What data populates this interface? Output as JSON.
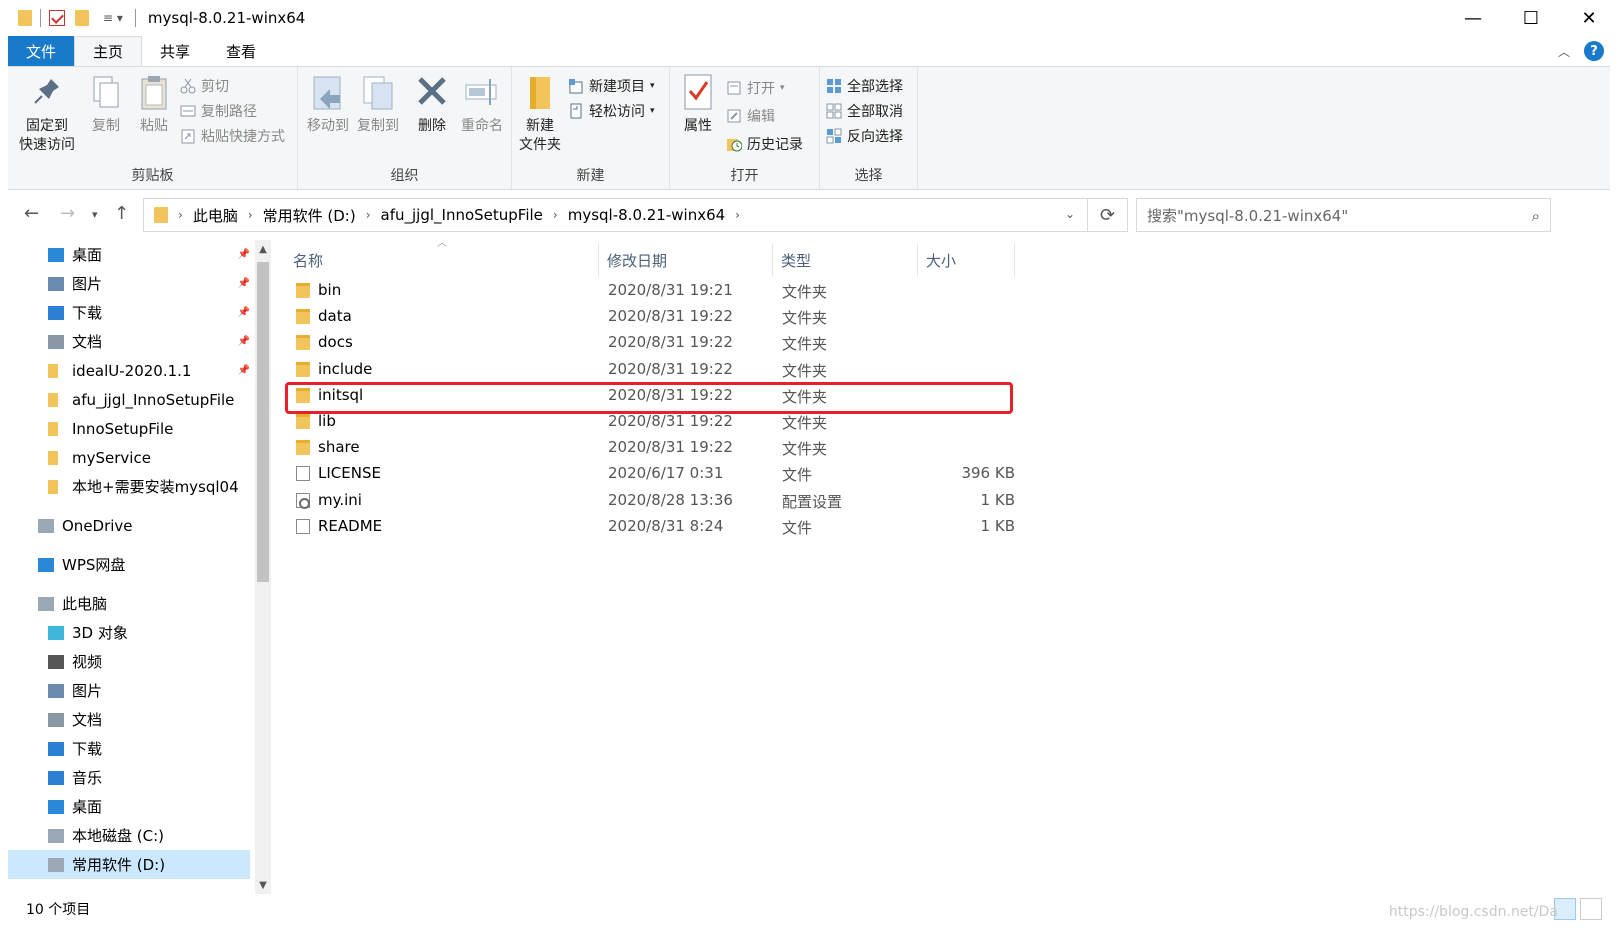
{
  "window": {
    "title": "mysql-8.0.21-winx64",
    "minimize": "—",
    "maximize": "☐",
    "close": "✕"
  },
  "ribbon_tabs": [
    {
      "label": "文件"
    },
    {
      "label": "主页"
    },
    {
      "label": "共享"
    },
    {
      "label": "查看"
    }
  ],
  "ribbon": {
    "clipboard": {
      "label": "剪贴板",
      "pin": "固定到\n快速访问",
      "copy": "复制",
      "paste": "粘贴",
      "cut": "剪切",
      "copy_path": "复制路径",
      "paste_shortcut": "粘贴快捷方式"
    },
    "organize": {
      "label": "组织",
      "move_to": "移动到",
      "copy_to": "复制到",
      "delete": "删除",
      "rename": "重命名"
    },
    "new": {
      "label": "新建",
      "new_folder": "新建\n文件夹",
      "new_item": "新建项目",
      "easy_access": "轻松访问"
    },
    "open": {
      "label": "打开",
      "properties": "属性",
      "open": "打开",
      "edit": "编辑",
      "history": "历史记录"
    },
    "select": {
      "label": "选择",
      "select_all": "全部选择",
      "select_none": "全部取消",
      "invert": "反向选择"
    }
  },
  "address": {
    "crumbs": [
      "此电脑",
      "常用软件 (D:)",
      "afu_jjgl_InnoSetupFile",
      "mysql-8.0.21-winx64"
    ],
    "search_placeholder": "搜索\"mysql-8.0.21-winx64\""
  },
  "nav_pane": {
    "quick_access": [
      {
        "label": "桌面",
        "icon": "desktop-icon",
        "pinned": true
      },
      {
        "label": "图片",
        "icon": "pictures-icon",
        "pinned": true
      },
      {
        "label": "下载",
        "icon": "download-icon",
        "pinned": true
      },
      {
        "label": "文档",
        "icon": "documents-icon",
        "pinned": true
      },
      {
        "label": "idealU-2020.1.1",
        "icon": "folder-icon",
        "pinned": true
      },
      {
        "label": "afu_jjgl_InnoSetupFile",
        "icon": "folder-icon",
        "pinned": false
      },
      {
        "label": "InnoSetupFile",
        "icon": "folder-icon",
        "pinned": false
      },
      {
        "label": "myService",
        "icon": "folder-icon",
        "pinned": false
      },
      {
        "label": "本地+需要安装mysql04",
        "icon": "folder-icon",
        "pinned": false
      }
    ],
    "onedrive": "OneDrive",
    "wps": "WPS网盘",
    "this_pc": "此电脑",
    "pc_items": [
      {
        "label": "3D 对象",
        "icon": "3d-objects-icon"
      },
      {
        "label": "视频",
        "icon": "videos-icon"
      },
      {
        "label": "图片",
        "icon": "pictures-icon"
      },
      {
        "label": "文档",
        "icon": "documents-icon"
      },
      {
        "label": "下载",
        "icon": "download-icon"
      },
      {
        "label": "音乐",
        "icon": "music-icon"
      },
      {
        "label": "桌面",
        "icon": "desktop-icon"
      },
      {
        "label": "本地磁盘 (C:)",
        "icon": "drive-icon"
      },
      {
        "label": "常用软件 (D:)",
        "icon": "drive-icon"
      }
    ]
  },
  "columns": {
    "name": "名称",
    "date": "修改日期",
    "type": "类型",
    "size": "大小"
  },
  "files": [
    {
      "name": "bin",
      "date": "2020/8/31 19:21",
      "type": "文件夹",
      "size": "",
      "kind": "folder"
    },
    {
      "name": "data",
      "date": "2020/8/31 19:22",
      "type": "文件夹",
      "size": "",
      "kind": "folder"
    },
    {
      "name": "docs",
      "date": "2020/8/31 19:22",
      "type": "文件夹",
      "size": "",
      "kind": "folder"
    },
    {
      "name": "include",
      "date": "2020/8/31 19:22",
      "type": "文件夹",
      "size": "",
      "kind": "folder"
    },
    {
      "name": "initsql",
      "date": "2020/8/31 19:22",
      "type": "文件夹",
      "size": "",
      "kind": "folder"
    },
    {
      "name": "lib",
      "date": "2020/8/31 19:22",
      "type": "文件夹",
      "size": "",
      "kind": "folder"
    },
    {
      "name": "share",
      "date": "2020/8/31 19:22",
      "type": "文件夹",
      "size": "",
      "kind": "folder"
    },
    {
      "name": "LICENSE",
      "date": "2020/6/17 0:31",
      "type": "文件",
      "size": "396 KB",
      "kind": "doc"
    },
    {
      "name": "my.ini",
      "date": "2020/8/28 13:36",
      "type": "配置设置",
      "size": "1 KB",
      "kind": "ini"
    },
    {
      "name": "README",
      "date": "2020/8/31 8:24",
      "type": "文件",
      "size": "1 KB",
      "kind": "doc"
    }
  ],
  "highlighted_file": "initsql",
  "status": {
    "count": "10 个项目"
  },
  "watermark": "https://blog.csdn.net/Da",
  "colors": {
    "accent": "#1979ca",
    "highlight_border": "#e8202a",
    "selected_nav": "#cce8ff"
  }
}
